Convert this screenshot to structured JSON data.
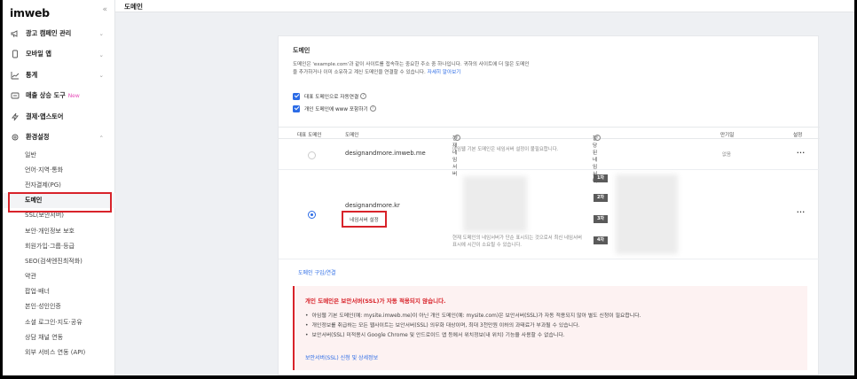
{
  "sidebar": {
    "logo": "imweb",
    "collapse_icon": "«",
    "menu": [
      {
        "label": "광고 캠페인 관리",
        "icon": "megaphone-icon",
        "chevron": "⌄"
      },
      {
        "label": "모바일 앱",
        "icon": "mobile-icon",
        "chevron": "⌄"
      },
      {
        "label": "통계",
        "icon": "chart-icon",
        "chevron": "⌄"
      },
      {
        "label": "매출 상승 도구",
        "icon": "tools-icon",
        "badge": "New"
      },
      {
        "label": "결제·앱스토어",
        "icon": "lightning-icon"
      },
      {
        "label": "환경설정",
        "icon": "gear-icon",
        "chevron": "⌃"
      }
    ],
    "submenu": [
      "일반",
      "언어·지역·통화",
      "전자결제(PG)",
      "도메인",
      "SSL(보안서버)",
      "보안·개인정보 보호",
      "회원가입·그룹·등급",
      "SEO(검색엔진최적화)",
      "약관",
      "팝업·배너",
      "본인·성인인증",
      "소셜 로그인·지도·공유",
      "상담 채널 연동",
      "외부 서비스 연동 (API)"
    ]
  },
  "topbar": {
    "title": "도메인"
  },
  "card": {
    "title": "도메인",
    "desc_line1": "도메인은 'example.com'과 같이 사이트를 접속하는 중요한 주소 중 하나입니다. 귀하의 사이트에 더 많은 도메인",
    "desc_line2": "을 추가하거나 이미 소유하고 계신 도메인을 연결할 수 있습니다.",
    "desc_link": "자세히 알아보기",
    "check1": "대표 도메인으로 자동연결",
    "check2": "개인 도메인에 www 포함하기",
    "headers": {
      "primary": "대표 도메인",
      "domain": "도메인",
      "current_ns": "현재 네임서버",
      "assigned_ns": "할당된 네임서버",
      "expiry": "만기일",
      "settings": "설정"
    },
    "row1": {
      "domain": "designandmore.imweb.me",
      "ns_note": "아임웹 기본 도메인은 네임서버 설정이 불필요합니다.",
      "expiry": "없음",
      "more": "···"
    },
    "row2": {
      "domain": "designandmore.kr",
      "ns_button": "네임서버 설정",
      "ns_note": "현재 도메인의 네임서버가 단순 표시되는 것으로서 최신 네임서버 표시에 시간이 소요될 수 있습니다.",
      "badges": [
        "1차",
        "2차",
        "3차",
        "4차"
      ],
      "more": "···"
    },
    "buy_link": "도메인 구입/연결",
    "warning": {
      "title": "개인 도메인은 보안서버(SSL)가 자동 적용되지 않습니다.",
      "items": [
        "아임웹 기본 도메인(예: mysite.imweb.me)이 아닌 개인 도메인(예: mysite.com)은 보안서버(SSL)가 자동 적용되지 않아 별도 신청이 필요합니다.",
        "개인정보를 취급하는 모든 웹사이트는 보안서버(SSL) 의무화 대상이며, 최대 3천만원 이하의 과태료가 부과될 수 있습니다.",
        "보안서버(SSL) 미적용시 Google Chrome 및 안드로이드 앱 등에서 위치정보(내 위치) 기능을 사용할 수 없습니다."
      ],
      "link": "보안서버(SSL) 신청 및 상세정보"
    }
  },
  "colors": {
    "accent": "#2b6be6",
    "warning": "#d8232a",
    "highlight": "#d8232a"
  }
}
